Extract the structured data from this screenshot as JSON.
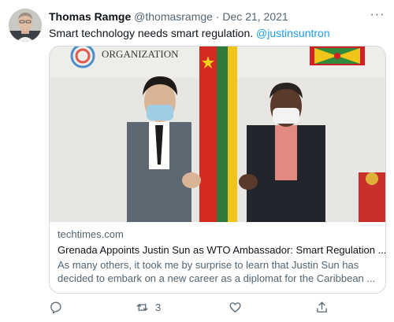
{
  "tweet": {
    "display_name": "Thomas Ramge",
    "handle": "@thomasramge",
    "separator": "·",
    "date": "Dec 21, 2021",
    "more_label": "···",
    "text": "Smart technology needs smart regulation.",
    "mention": "@justinsuntron"
  },
  "card": {
    "image_text": "ORGANIZATION",
    "domain": "techtimes.com",
    "title": "Grenada Appoints Justin Sun as WTO Ambassador: Smart Regulation ...",
    "description": "As many others, it took me by surprise to learn that Justin Sun has decided to embark on a new career as a diplomat for the Caribbean ..."
  },
  "actions": {
    "reply_count": "",
    "retweet_count": "3",
    "like_count": "",
    "share_count": ""
  },
  "colors": {
    "link": "#1d9bf0",
    "secondary_text": "#536471",
    "border": "#cfd9de"
  }
}
